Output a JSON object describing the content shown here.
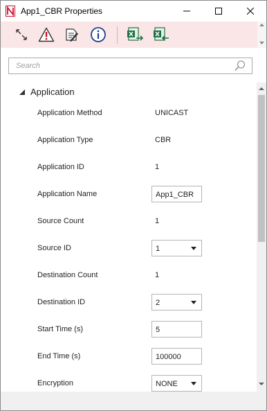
{
  "window": {
    "title": "App1_CBR Properties"
  },
  "toolbar": {
    "buttons": [
      {
        "icon": "resize-arrows-icon"
      },
      {
        "icon": "warning-icon"
      },
      {
        "icon": "edit-note-icon"
      },
      {
        "icon": "info-icon"
      },
      {
        "icon": "excel-export-icon"
      },
      {
        "icon": "excel-import-icon"
      }
    ]
  },
  "search": {
    "placeholder": "Search"
  },
  "section": {
    "label": "Application"
  },
  "properties": [
    {
      "label": "Application Method",
      "value": "UNICAST"
    },
    {
      "label": "Application Type",
      "value": "CBR"
    },
    {
      "label": "Application ID",
      "value": "1"
    },
    {
      "label": "Application Name",
      "value": "App1_CBR"
    },
    {
      "label": "Source Count",
      "value": "1"
    },
    {
      "label": "Source ID",
      "value": "1"
    },
    {
      "label": "Destination Count",
      "value": "1"
    },
    {
      "label": "Destination ID",
      "value": "2"
    },
    {
      "label": "Start Time (s)",
      "value": "5"
    },
    {
      "label": "End Time (s)",
      "value": "100000"
    },
    {
      "label": "Encryption",
      "value": "NONE"
    }
  ],
  "colors": {
    "toolbar_bg": "#fae6e6",
    "accent_red": "#c8102e",
    "info_blue": "#1f3f8f",
    "excel_green": "#1d7044"
  }
}
